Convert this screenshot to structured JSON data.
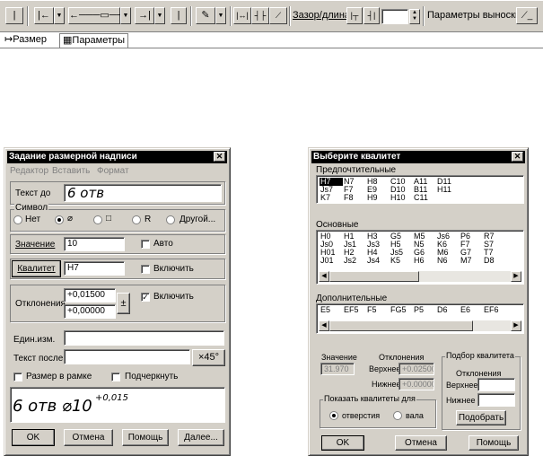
{
  "toolbar": {
    "gap_length_label": "Зазор/длина",
    "leader_params_label": "Параметры выноски"
  },
  "tabs": [
    {
      "label": "Размер"
    },
    {
      "label": "Параметры"
    }
  ],
  "dim_dialog": {
    "title": "Задание размерной надписи",
    "menu": [
      "Редактор",
      "Вставить",
      "Формат"
    ],
    "text_before_label": "Текст до",
    "text_before_value": "6 отв",
    "symbol_group": "Символ",
    "symbols": [
      {
        "label": "Нет",
        "checked": false
      },
      {
        "label": "⌀",
        "checked": true
      },
      {
        "label": "□",
        "checked": false
      },
      {
        "label": "R",
        "checked": false
      },
      {
        "label": "Другой...",
        "checked": false
      }
    ],
    "value_label": "Значение",
    "value": "10",
    "auto_label": "Авто",
    "qualitet_button": "Квалитет",
    "qualitet_value": "H7",
    "include_label": "Включить",
    "deviations_label": "Отклонения",
    "dev_upper": "+0,01500",
    "dev_lower": "+0,00000",
    "plusminus": "±",
    "dev_include_label": "Включить",
    "units_label": "Един.изм.",
    "text_after_label": "Текст после",
    "x45_button": "×45°",
    "in_frame_label": "Размер в рамке",
    "underline_label": "Подчеркнуть",
    "preview_main": "6 отв ⌀10",
    "preview_sup": "+0,015",
    "buttons": {
      "ok": "OK",
      "cancel": "Отмена",
      "help": "Помощь",
      "more": "Далее..."
    }
  },
  "qual_dialog": {
    "title": "Выберите квалитет",
    "preferred_label": "Предпочтительные",
    "preferred": [
      [
        "H7",
        "N7",
        "H8",
        "C10",
        "A11",
        "D11",
        "",
        ""
      ],
      [
        "Js7",
        "F7",
        "E9",
        "D10",
        "B11",
        "H11",
        "",
        ""
      ],
      [
        "K7",
        "F8",
        "H9",
        "H10",
        "C11",
        "",
        "",
        ""
      ]
    ],
    "basic_label": "Основные",
    "basic": [
      [
        "H0",
        "H1",
        "H3",
        "G5",
        "M5",
        "Js6",
        "P6",
        "R7"
      ],
      [
        "Js0",
        "Js1",
        "Js3",
        "H5",
        "N5",
        "K6",
        "F7",
        "S7"
      ],
      [
        "H01",
        "H2",
        "H4",
        "Js5",
        "G6",
        "M6",
        "G7",
        "T7"
      ],
      [
        "J01",
        "Js2",
        "Js4",
        "K5",
        "H6",
        "N6",
        "M7",
        "D8"
      ]
    ],
    "additional_label": "Дополнительные",
    "additional": [
      [
        "E5",
        "EF5",
        "F5",
        "FG5",
        "P5",
        "D6",
        "E6",
        "EF6"
      ]
    ],
    "value_label": "Значение",
    "value": "31.970",
    "deviations_label": "Отклонения",
    "upper_label": "Верхнее",
    "upper_value": "+0.02500",
    "lower_label": "Нижнее",
    "lower_value": "+0.00000",
    "show_for_label": "Показать квалитеты для",
    "hole_label": "отверстия",
    "shaft_label": "вала",
    "pick_group_label": "Подбор квалитета",
    "pick_dev_label": "Отклонения",
    "pick_upper_label": "Верхнее",
    "pick_lower_label": "Нижнее",
    "pick_button": "Подобрать",
    "buttons": {
      "ok": "OK",
      "cancel": "Отмена",
      "help": "Помощь"
    }
  }
}
